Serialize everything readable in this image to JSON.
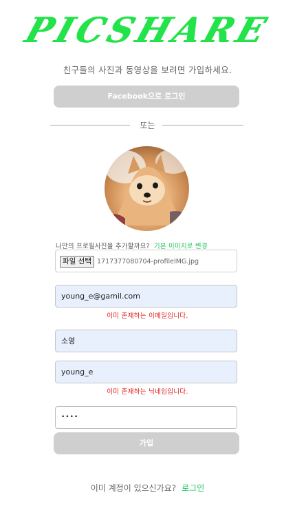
{
  "logo": "PICSHARE",
  "subtitle": "친구들의 사진과 동영상을 보려면 가입하세요.",
  "facebook_button": "Facebook으로 로그인",
  "divider": "또는",
  "profile": {
    "prompt": "나만의 프로필사진을 추가할까요?",
    "reset_link": "기본 이미지로 변경",
    "file_button": "파일 선택",
    "file_name": "1717377080704-profileIMG.jpg"
  },
  "fields": {
    "email": "young_e@gamil.com",
    "email_error": "이미 존재하는 이메일입니다.",
    "name": "소영",
    "nickname": "young_e",
    "nickname_error": "이미 존재하는 닉네임입니다.",
    "password": "••••"
  },
  "signup_button": "가입",
  "footer": {
    "prompt": "이미 계정이 있으신가요?",
    "login_link": "로그인"
  },
  "colors": {
    "brand": "#22e34a",
    "link": "#22c55e",
    "error": "#e11d1d",
    "button_disabled": "#cfcfcf",
    "autofill": "#e8f0fe"
  }
}
